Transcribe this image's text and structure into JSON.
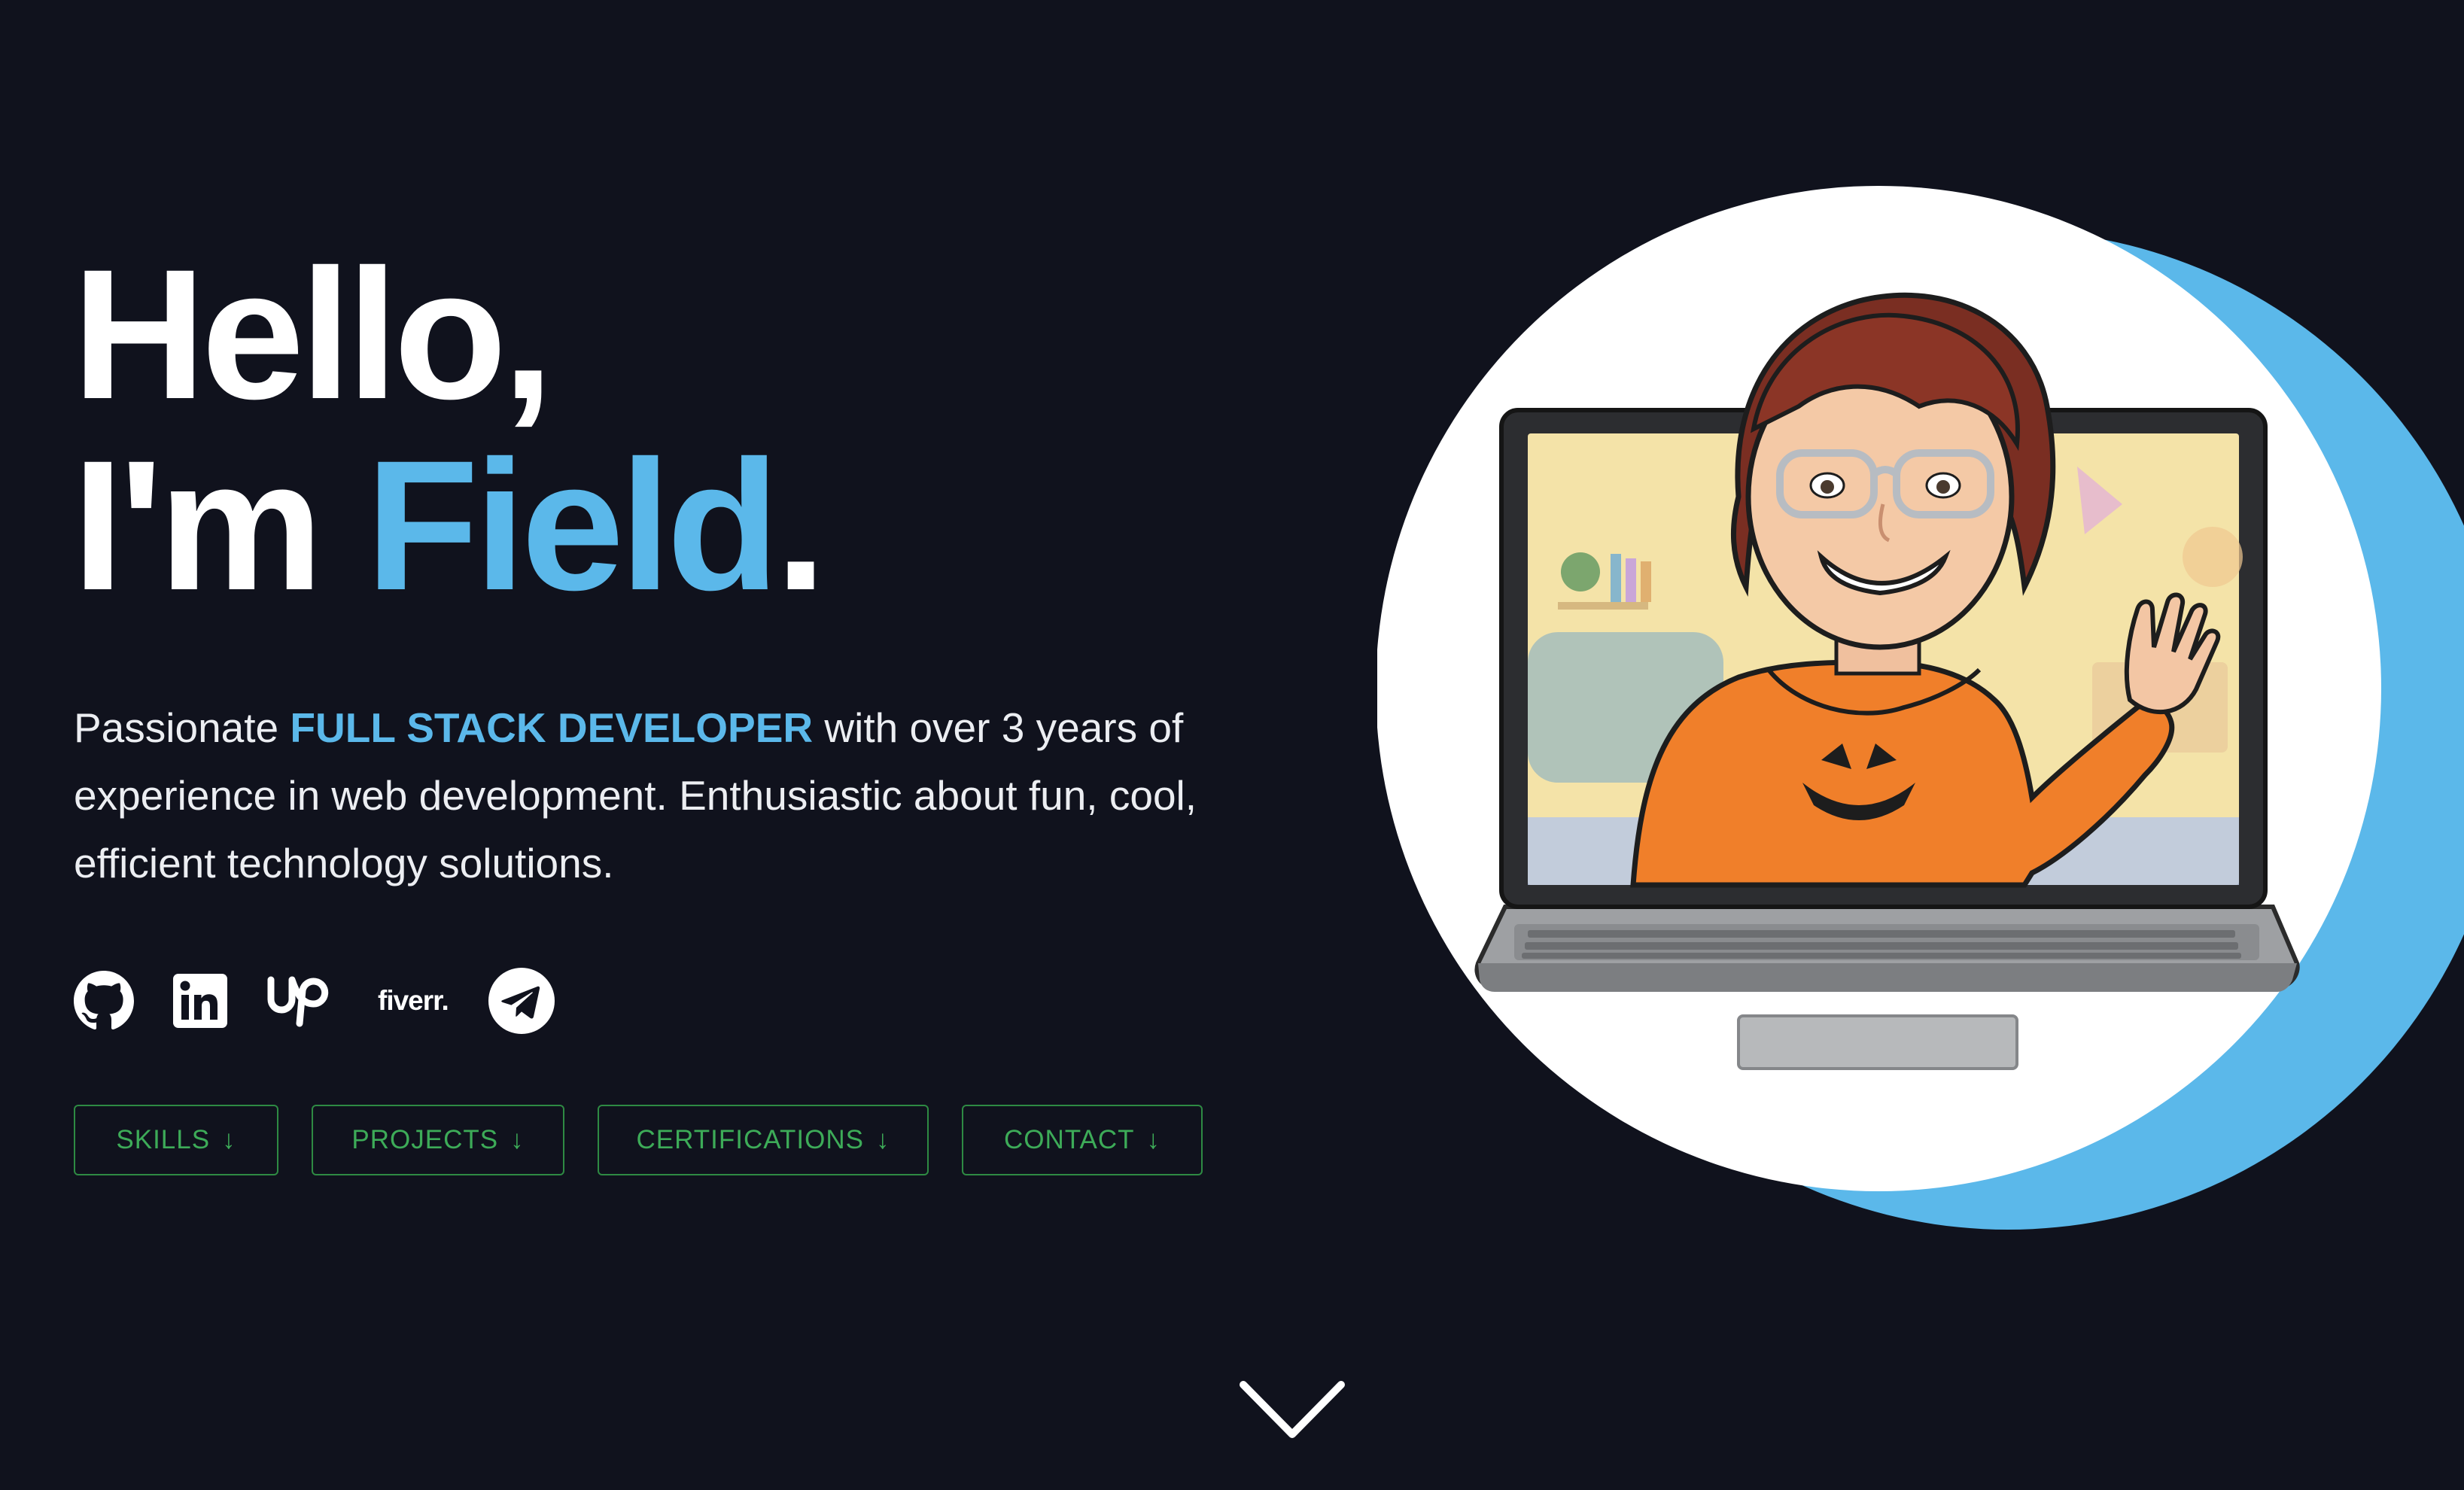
{
  "hero": {
    "greeting": "Hello,",
    "intro_prefix": "I'm ",
    "name": "Field",
    "name_suffix": "."
  },
  "intro": {
    "before": "Passionate ",
    "role": "FULL STACK DEVELOPER",
    "after": " with over 3 years of experience in web development. Enthusiastic about fun, cool, efficient technology solutions."
  },
  "socials": [
    {
      "name": "GitHub",
      "icon": "github-icon"
    },
    {
      "name": "LinkedIn",
      "icon": "linkedin-icon"
    },
    {
      "name": "Upwork",
      "icon": "upwork-icon"
    },
    {
      "name": "Fiverr",
      "icon": "fiverr-icon",
      "text": "fiverr."
    },
    {
      "name": "Telegram",
      "icon": "telegram-icon"
    }
  ],
  "nav": {
    "skills": "SKILLS",
    "projects": "PROJECTS",
    "certifications": "CERTIFICATIONS",
    "contact": "CONTACT",
    "arrow": "↓"
  },
  "colors": {
    "background": "#10121d",
    "accent": "#5bb8ea",
    "button": "#3dab58"
  },
  "scroll_icon": "chevron-down-icon"
}
